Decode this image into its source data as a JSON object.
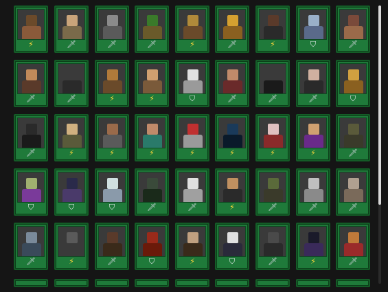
{
  "colors": {
    "card_bg": "#1f7a3a",
    "card_border": "#145c27",
    "background": "#151515",
    "lightning": "#ffd83a",
    "sword": "#c9d2d6",
    "shield": "#e9eef0"
  },
  "icon_glyphs": {
    "lightning": "⚡",
    "sword": "🗡",
    "shield": "⛉"
  },
  "rows": [
    [
      "lightning",
      "sword",
      "sword",
      "sword",
      "lightning",
      "sword",
      "lightning",
      "shield",
      "sword"
    ],
    [
      "sword",
      "sword",
      "lightning",
      "lightning",
      "shield",
      "sword",
      "sword",
      "sword",
      "shield"
    ],
    [
      "sword",
      "lightning",
      "lightning",
      "lightning",
      "lightning",
      "lightning",
      "lightning",
      "lightning",
      "sword"
    ],
    [
      "shield",
      "shield",
      "shield",
      "sword",
      "sword",
      "lightning",
      "sword",
      "sword",
      "sword"
    ],
    [
      "sword",
      "lightning",
      "sword",
      "shield",
      "lightning",
      "shield",
      "sword",
      "lightning",
      "sword"
    ]
  ],
  "character_palettes": [
    [
      "#6b4a2a",
      "#8a5a3a"
    ],
    [
      "#c9a47a",
      "#7a6a4a"
    ],
    [
      "#8a8a8a",
      "#5a5a5a"
    ],
    [
      "#3a7a2a",
      "#6a5a2a"
    ],
    [
      "#b08a3a",
      "#6a4a2a"
    ],
    [
      "#d4a030",
      "#8a6020"
    ],
    [
      "#5a3a2a",
      "#2a2a2a"
    ],
    [
      "#9ab0c8",
      "#5a6a8a"
    ],
    [
      "#7a4a3a",
      "#9a6a4a"
    ],
    [
      "#c08a5a",
      "#5a3a2a"
    ],
    [
      "#3a3a3a",
      "#2a2a2a"
    ],
    [
      "#b07a3a",
      "#6a4a2a"
    ],
    [
      "#d0a070",
      "#7a5a3a"
    ],
    [
      "#e0e0e0",
      "#9a9a9a"
    ],
    [
      "#c08a6a",
      "#6a2a2a"
    ],
    [
      "#3a3a3a",
      "#1a1a1a"
    ],
    [
      "#d0b0a0",
      "#2a2a2a"
    ],
    [
      "#d0a040",
      "#8a6020"
    ],
    [
      "#2a2a2a",
      "#1a1a1a"
    ],
    [
      "#d0b080",
      "#5a5a3a"
    ],
    [
      "#9a6a4a",
      "#5a5a5a"
    ],
    [
      "#c08a6a",
      "#2a7a6a"
    ],
    [
      "#c03030",
      "#9a9a9a"
    ],
    [
      "#1a3a5a",
      "#0a1a2a"
    ],
    [
      "#e0c0c0",
      "#8a2a2a"
    ],
    [
      "#d0a070",
      "#6a2a8a"
    ],
    [
      "#5a5a3a",
      "#3a3a2a"
    ],
    [
      "#a0b070",
      "#7a3a9a"
    ],
    [
      "#2a2a4a",
      "#4a3a6a"
    ],
    [
      "#d0e0e0",
      "#8a9aaa"
    ],
    [
      "#3a4a3a",
      "#1a2a1a"
    ],
    [
      "#e0e0e0",
      "#a0a0a0"
    ],
    [
      "#c09060",
      "#2a2a2a"
    ],
    [
      "#5a6a3a",
      "#3a3a2a"
    ],
    [
      "#c0c0c0",
      "#8a8a8a"
    ],
    [
      "#b0a090",
      "#7a6a5a"
    ],
    [
      "#7a8a9a",
      "#3a4a5a"
    ],
    [
      "#5a5a5a",
      "#3a3a3a"
    ],
    [
      "#5a3a2a",
      "#3a2a1a"
    ],
    [
      "#9a2a1a",
      "#6a1a0a"
    ],
    [
      "#c0a080",
      "#3a2a1a"
    ],
    [
      "#e0e0e0",
      "#2a2a3a"
    ],
    [
      "#4a4a4a",
      "#2a2a2a"
    ],
    [
      "#1a1a2a",
      "#3a2a5a"
    ],
    [
      "#c07a3a",
      "#9a2a2a"
    ]
  ]
}
